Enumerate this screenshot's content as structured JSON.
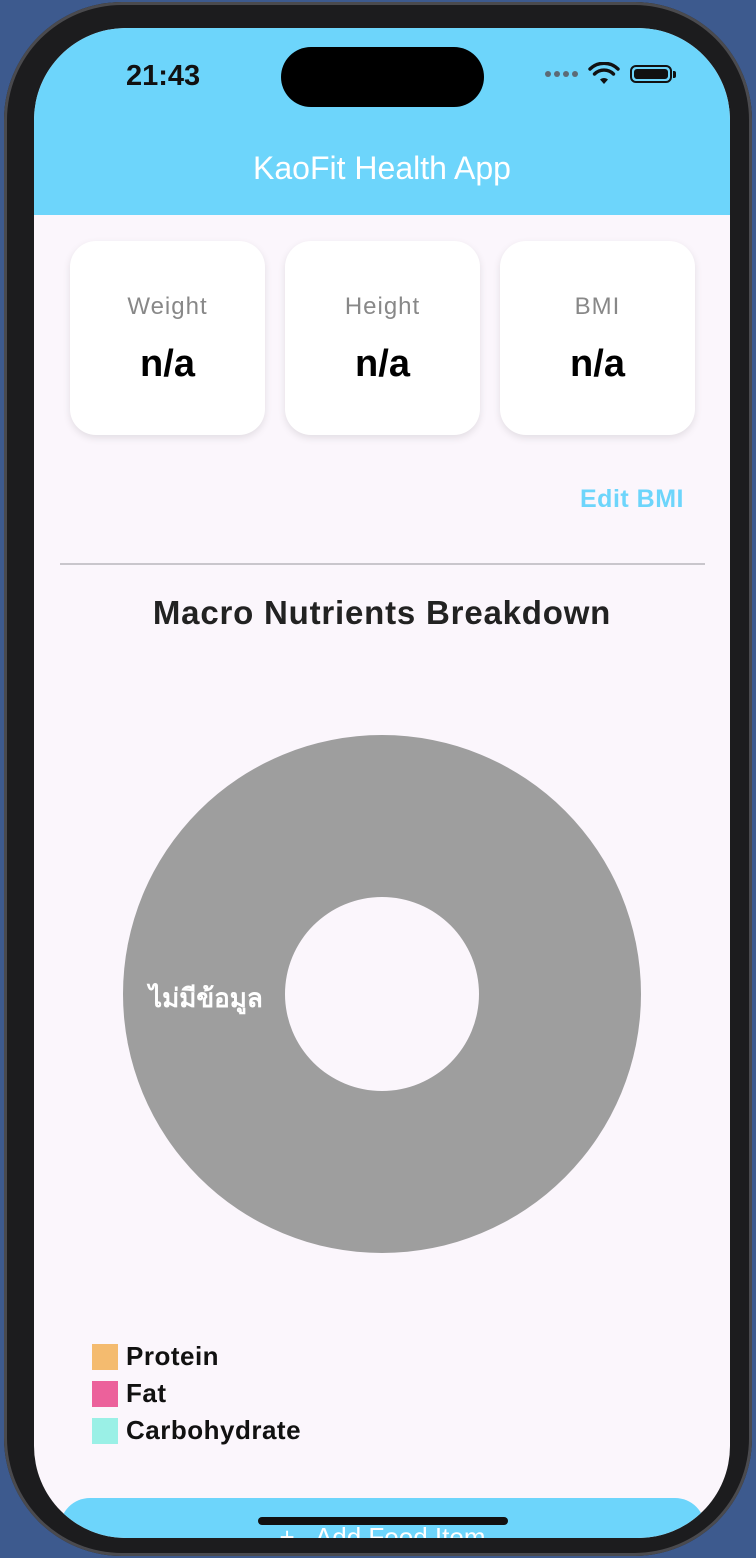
{
  "status_bar": {
    "time": "21:43"
  },
  "header": {
    "title": "KaoFit Health App"
  },
  "stats": [
    {
      "label": "Weight",
      "value": "n/a"
    },
    {
      "label": "Height",
      "value": "n/a"
    },
    {
      "label": "BMI",
      "value": "n/a"
    }
  ],
  "edit_bmi_label": "Edit BMI",
  "macro_section": {
    "title": "Macro Nutrients Breakdown"
  },
  "chart_data": {
    "type": "pie",
    "title": "Macro Nutrients Breakdown",
    "donut": true,
    "slices": [
      {
        "label": "ไม่มีข้อมูล",
        "value": 100,
        "color": "#9e9e9e"
      }
    ],
    "legend": [
      {
        "name": "Protein",
        "color": "#f4bb6f"
      },
      {
        "name": "Fat",
        "color": "#ec619b"
      },
      {
        "name": "Carbohydrate",
        "color": "#9af0e6"
      }
    ]
  },
  "add_food_button": {
    "icon": "plus-icon",
    "label": "Add Food Item"
  },
  "colors": {
    "accent": "#6dd5fb",
    "background": "#fbf6fc",
    "no_data": "#9e9e9e"
  }
}
